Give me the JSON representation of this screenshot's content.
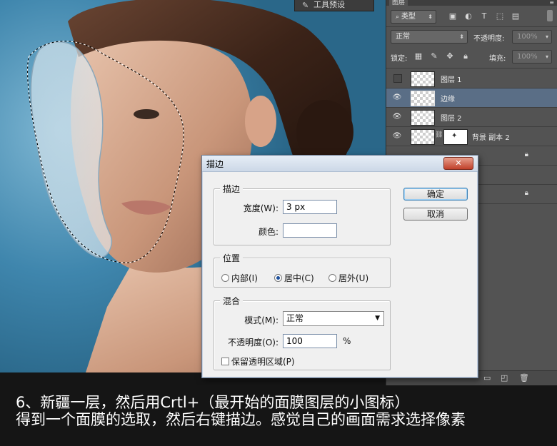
{
  "tool_chip": {
    "label": "工具预设"
  },
  "layers_panel": {
    "tab": "图层",
    "filter": {
      "label": "类型"
    },
    "blend_mode": "正常",
    "opacity": {
      "label": "不透明度:",
      "value": "100%"
    },
    "lock_label": "锁定:",
    "fill": {
      "label": "填充:",
      "value": "100%"
    },
    "layers": [
      {
        "name": "图层 1",
        "visible": false,
        "selected": false
      },
      {
        "name": "边缘",
        "visible": true,
        "selected": true
      },
      {
        "name": "图层 2",
        "visible": true,
        "selected": false
      },
      {
        "name": "背景 副本 2",
        "visible": true,
        "selected": false,
        "has_mask": true
      }
    ]
  },
  "dialog": {
    "title": "描边",
    "stroke_group": {
      "title": "描边",
      "width_label": "宽度(W):",
      "width_value": "3 px",
      "color_label": "颜色:"
    },
    "position_group": {
      "title": "位置",
      "options": [
        "内部(I)",
        "居中(C)",
        "居外(U)"
      ],
      "selected_index": 1
    },
    "blend_group": {
      "title": "混合",
      "mode_label": "模式(M):",
      "mode_value": "正常",
      "opacity_label": "不透明度(O):",
      "opacity_value": "100",
      "opacity_unit": "%",
      "preserve_label": "保留透明区域(P)",
      "preserve_checked": false
    },
    "ok_label": "确定",
    "cancel_label": "取消",
    "close_symbol": "✕"
  },
  "caption": {
    "line1": "6、新疆一层，然后用Crtl+（最开始的面膜图层的小图标）",
    "line2": "得到一个面膜的选取，然后右键描边。感觉自己的画面需求选择像素"
  },
  "colors": {
    "panel_bg": "#535353",
    "selected_layer": "#5a6e86",
    "dialog_bg": "#f0f0f0",
    "close_button": "#c0402a",
    "caption_bg": "#151515"
  }
}
